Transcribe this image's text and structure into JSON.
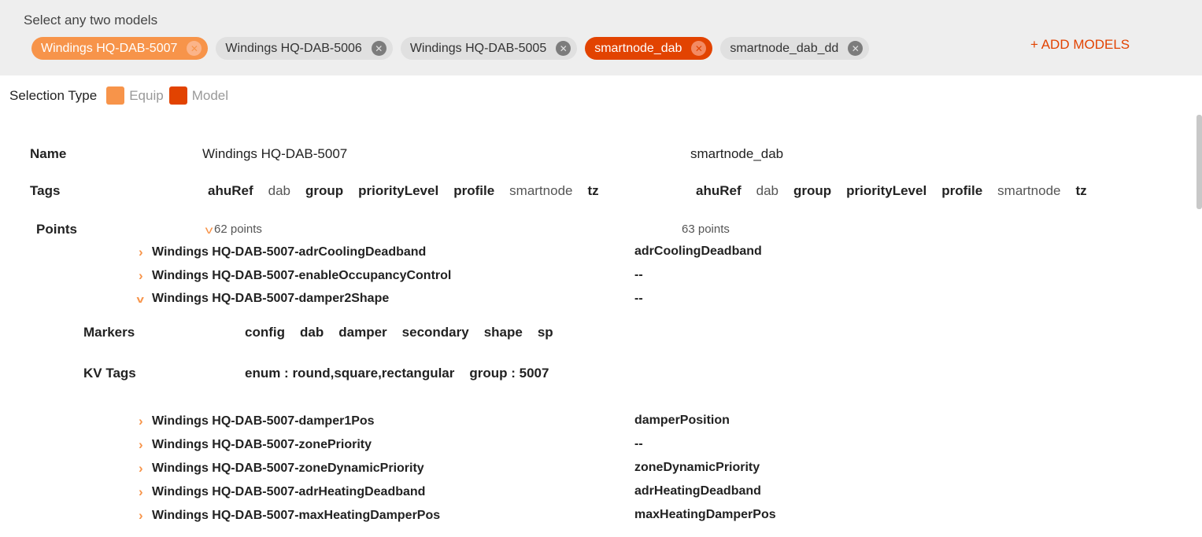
{
  "header": {
    "select_label": "Select any two models",
    "chips": [
      {
        "label": "Windings HQ-DAB-5007",
        "state": "equip"
      },
      {
        "label": "Windings HQ-DAB-5006",
        "state": "plain"
      },
      {
        "label": "Windings HQ-DAB-5005",
        "state": "plain"
      },
      {
        "label": "smartnode_dab",
        "state": "model"
      },
      {
        "label": "smartnode_dab_dd",
        "state": "plain"
      }
    ],
    "add_models": "+ ADD MODELS"
  },
  "selection_type": {
    "label": "Selection Type",
    "equip": "Equip",
    "model": "Model",
    "equip_color": "#f7944a",
    "model_color": "#e24301"
  },
  "compare": {
    "name_label": "Name",
    "name_left": "Windings HQ-DAB-5007",
    "name_right": "smartnode_dab",
    "tags_label": "Tags",
    "tags_left": [
      {
        "t": "ahuRef",
        "bold": true
      },
      {
        "t": "dab",
        "bold": false
      },
      {
        "t": "group",
        "bold": true
      },
      {
        "t": "priorityLevel",
        "bold": true
      },
      {
        "t": "profile",
        "bold": true
      },
      {
        "t": "smartnode",
        "bold": false
      },
      {
        "t": "tz",
        "bold": true
      }
    ],
    "tags_right": [
      {
        "t": "ahuRef",
        "bold": true
      },
      {
        "t": "dab",
        "bold": false
      },
      {
        "t": "group",
        "bold": true
      },
      {
        "t": "priorityLevel",
        "bold": true
      },
      {
        "t": "profile",
        "bold": true
      },
      {
        "t": "smartnode",
        "bold": false
      },
      {
        "t": "tz",
        "bold": true
      }
    ],
    "points_label": "Points",
    "points_left": "62 points",
    "points_right": "63 points"
  },
  "points": [
    {
      "name": "Windings HQ-DAB-5007-adrCoolingDeadband",
      "map": "adrCoolingDeadband",
      "expanded": false
    },
    {
      "name": "Windings HQ-DAB-5007-enableOccupancyControl",
      "map": "--",
      "expanded": false
    },
    {
      "name": "Windings HQ-DAB-5007-damper2Shape",
      "map": "--",
      "expanded": true
    },
    {
      "name": "Windings HQ-DAB-5007-damper1Pos",
      "map": "damperPosition",
      "expanded": false
    },
    {
      "name": "Windings HQ-DAB-5007-zonePriority",
      "map": "--",
      "expanded": false
    },
    {
      "name": "Windings HQ-DAB-5007-zoneDynamicPriority",
      "map": "zoneDynamicPriority",
      "expanded": false
    },
    {
      "name": "Windings HQ-DAB-5007-adrHeatingDeadband",
      "map": "adrHeatingDeadband",
      "expanded": false
    },
    {
      "name": "Windings HQ-DAB-5007-maxHeatingDamperPos",
      "map": "maxHeatingDamperPos",
      "expanded": false
    }
  ],
  "detail": {
    "markers_label": "Markers",
    "markers": [
      "config",
      "dab",
      "damper",
      "secondary",
      "shape",
      "sp"
    ],
    "kv_label": "KV Tags",
    "kv": [
      "enum : round,square,rectangular",
      "group : 5007"
    ]
  }
}
